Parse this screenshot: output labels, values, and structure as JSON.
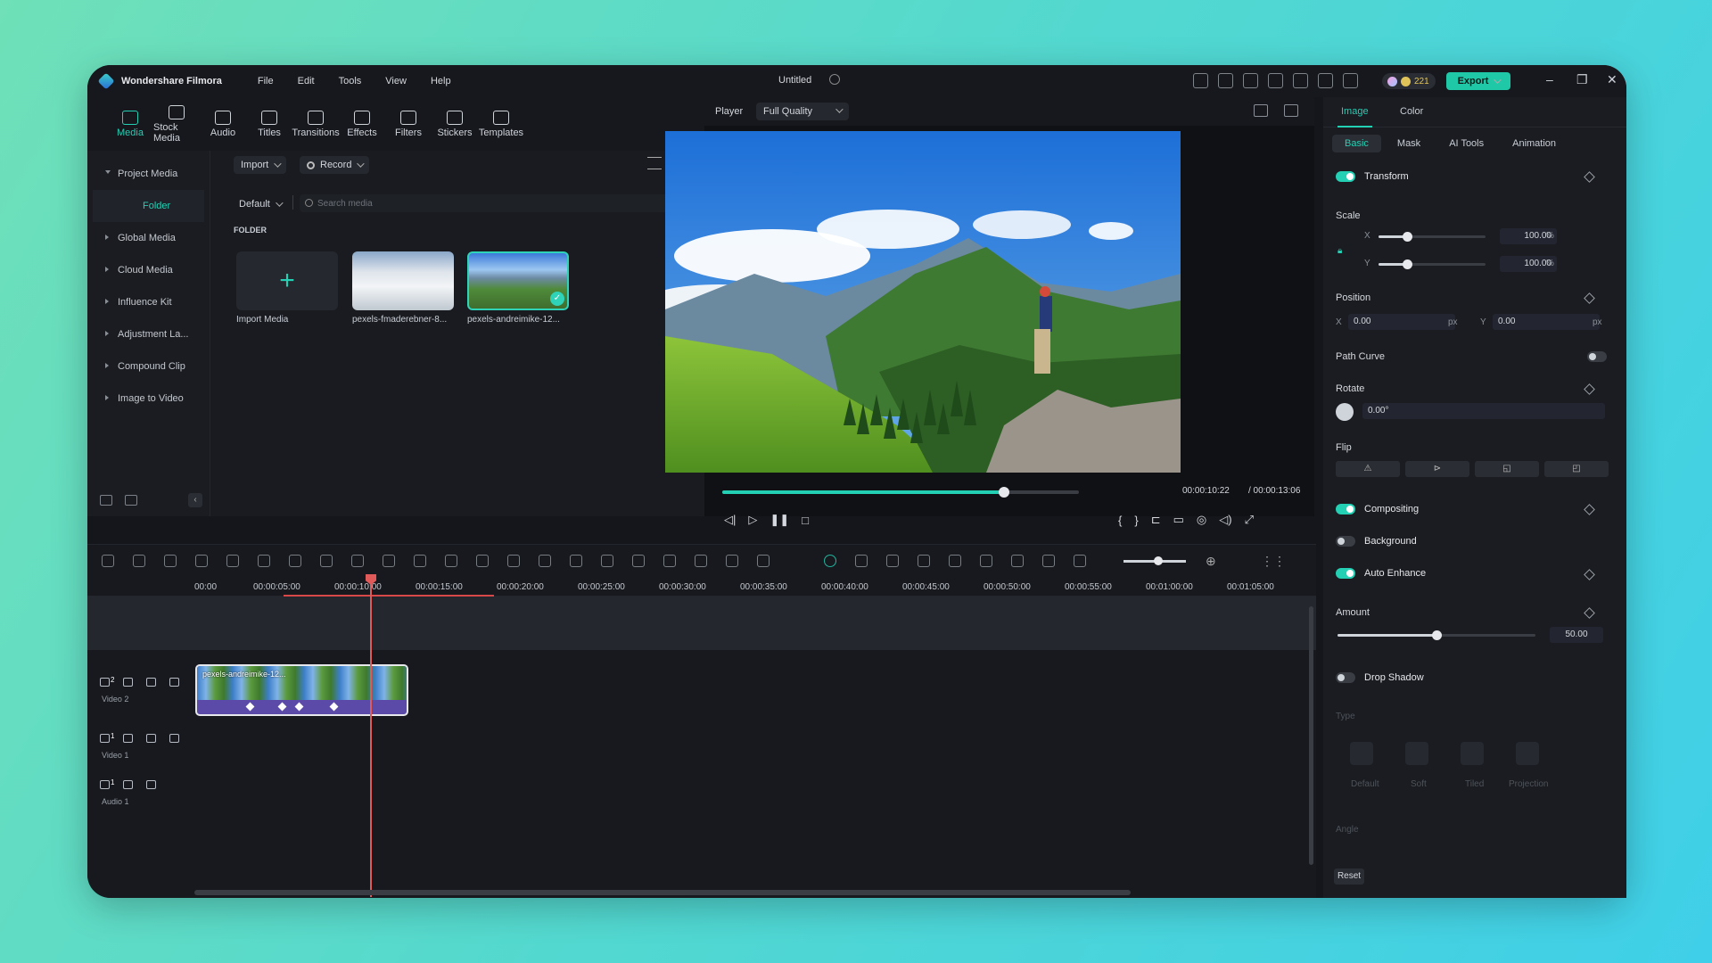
{
  "app": {
    "name": "Wondershare Filmora",
    "menus": [
      "File",
      "Edit",
      "Tools",
      "View",
      "Help"
    ],
    "doc_title": "Untitled",
    "credits": "221",
    "export_label": "Export"
  },
  "media_tabs": [
    "Media",
    "Stock Media",
    "Audio",
    "Titles",
    "Transitions",
    "Effects",
    "Filters",
    "Stickers",
    "Templates"
  ],
  "sidebar": {
    "items": [
      {
        "label": "Project Media"
      },
      {
        "label": "Folder"
      },
      {
        "label": "Global Media"
      },
      {
        "label": "Cloud Media"
      },
      {
        "label": "Influence Kit"
      },
      {
        "label": "Adjustment La..."
      },
      {
        "label": "Compound Clip"
      },
      {
        "label": "Image to Video"
      }
    ]
  },
  "media": {
    "import_label": "Import",
    "record_label": "Record",
    "sort_label": "Default",
    "search_placeholder": "Search media",
    "folder_title": "FOLDER",
    "cards": [
      "Import Media",
      "pexels-fmaderebner-8...",
      "pexels-andreimike-12..."
    ]
  },
  "player": {
    "label": "Player",
    "quality": "Full Quality",
    "current_time": "00:00:10:22",
    "total_time": "/ 00:00:13:06",
    "progress": 0.79
  },
  "panel": {
    "tabs": [
      "Image",
      "Color"
    ],
    "subtabs": [
      "Basic",
      "Mask",
      "AI Tools",
      "Animation"
    ],
    "transform": "Transform",
    "scale": "Scale",
    "scale_x": "100.00",
    "scale_y": "100.00",
    "scale_unit": "%",
    "x_label": "X",
    "y_label": "Y",
    "position": "Position",
    "pos_x": "0.00",
    "pos_y": "0.00",
    "px_unit": "px",
    "path_curve": "Path Curve",
    "rotate": "Rotate",
    "rotate_value": "0.00°",
    "flip": "Flip",
    "compositing": "Compositing",
    "background": "Background",
    "auto_enhance": "Auto Enhance",
    "amount": "Amount",
    "amount_value": "50.00",
    "amount_fraction": 0.5,
    "drop_shadow": "Drop Shadow",
    "type_label": "Type",
    "shadow_types": [
      "Default",
      "Soft",
      "Tiled",
      "Projection"
    ],
    "angle_label": "Angle",
    "reset_label": "Reset"
  },
  "timeline": {
    "ticks": [
      "00:00",
      "00:00:05:00",
      "00:00:10:00",
      "00:00:15:00",
      "00:00:20:00",
      "00:00:25:00",
      "00:00:30:00",
      "00:00:35:00",
      "00:00:40:00",
      "00:00:45:00",
      "00:00:50:00",
      "00:00:55:00",
      "00:01:00:00",
      "00:01:05:00"
    ],
    "tracks": [
      {
        "num": "2",
        "name": "Video 2"
      },
      {
        "num": "1",
        "name": "Video 1"
      },
      {
        "num": "1",
        "name": "Audio 1"
      }
    ],
    "clip_name": "pexels-andreimike-12..."
  },
  "colors": {
    "accent": "#23d0b4",
    "playhead": "#e05a5a",
    "clip": "#5b4aa8"
  }
}
